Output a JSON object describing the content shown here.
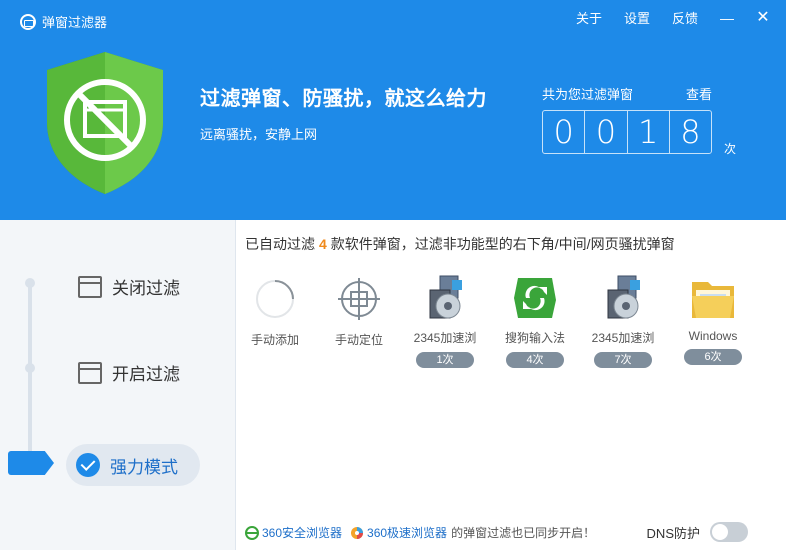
{
  "window": {
    "title": "弹窗过滤器",
    "nav": [
      "关于",
      "设置",
      "反馈"
    ],
    "minimize_glyph": "—",
    "close_glyph": "✕"
  },
  "hero": {
    "slogan": "过滤弹窗、防骚扰，就这么给力",
    "subslogan": "远离骚扰，安静上网"
  },
  "counter": {
    "label": "共为您过滤弹窗",
    "view": "查看",
    "digits": [
      "0",
      "0",
      "1",
      "8"
    ],
    "unit": "次"
  },
  "sidebar": {
    "modes": [
      {
        "label": "关闭过滤",
        "icon": "checkbox-window-icon"
      },
      {
        "label": "开启过滤",
        "icon": "window-icon"
      },
      {
        "label": "强力模式",
        "icon": "check-circle-icon",
        "active": true
      }
    ]
  },
  "main": {
    "summary_prefix": "已自动过滤",
    "summary_count": "4",
    "summary_suffix": "款软件弹窗，过滤非功能型的右下角/中间/网页骚扰弹窗",
    "tools": [
      {
        "label": "手动添加",
        "icon": "loading-circle-icon"
      },
      {
        "label": "手动定位",
        "icon": "crosshair-icon"
      }
    ],
    "apps": [
      {
        "name": "2345加速浏",
        "count": "1次",
        "icon": "installer-icon"
      },
      {
        "name": "搜狗输入法",
        "count": "4次",
        "icon": "sogou-icon"
      },
      {
        "name": "2345加速浏",
        "count": "7次",
        "icon": "installer-icon"
      },
      {
        "name": "Windows",
        "count": "6次",
        "icon": "folder-icon"
      }
    ]
  },
  "footer": {
    "browser1": "360安全浏览器",
    "browser2": "360极速浏览器",
    "suffix": "的弹窗过滤也已同步开启！",
    "dns_label": "DNS防护",
    "dns_enabled": false
  },
  "colors": {
    "brand_blue": "#1e8ae8",
    "shield_green": "#5cc03c",
    "accent_orange": "#f08a1c"
  }
}
